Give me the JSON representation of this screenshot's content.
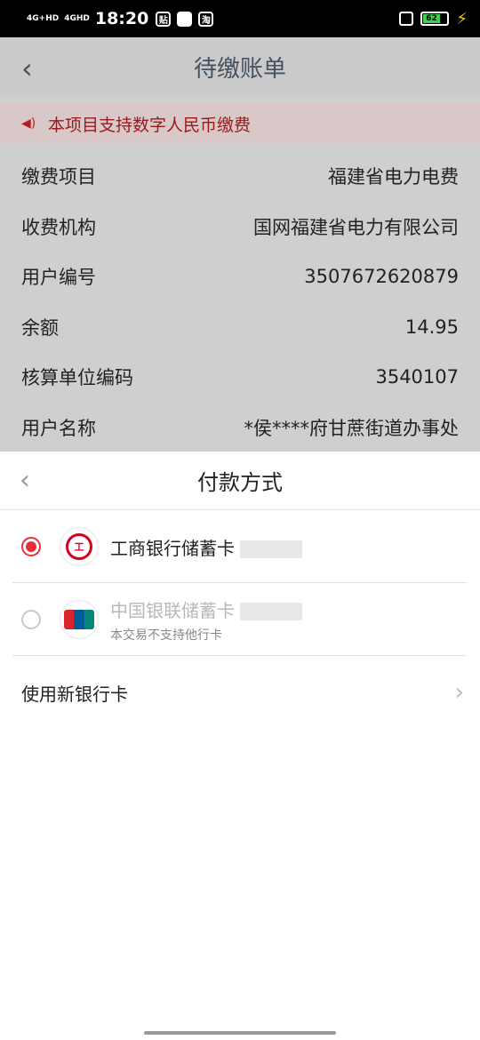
{
  "status_bar": {
    "signal1": "4G+HD",
    "signal2": "4GHD",
    "time": "18:20",
    "app_icon_text": "贴",
    "app_icon2_text": "淘",
    "battery": "62"
  },
  "page": {
    "title": "待缴账单",
    "notice": "本项目支持数字人民币缴费",
    "rows": [
      {
        "label": "缴费项目",
        "value": "福建省电力电费"
      },
      {
        "label": "收费机构",
        "value": "国网福建省电力有限公司"
      },
      {
        "label": "用户编号",
        "value": "3507672620879"
      },
      {
        "label": "余额",
        "value": "14.95"
      },
      {
        "label": "核算单位编码",
        "value": "3540107"
      },
      {
        "label": "用户名称",
        "value": "*侯****府甘蔗街道办事处"
      }
    ]
  },
  "sheet": {
    "title": "付款方式",
    "methods": [
      {
        "name": "工商银行储蓄卡",
        "selected": true
      },
      {
        "name": "中国银联储蓄卡",
        "sub": "本交易不支持他行卡",
        "selected": false
      }
    ],
    "new_card": "使用新银行卡"
  },
  "colors": {
    "accent": "#e8303a",
    "notice_text": "#a0171b"
  }
}
